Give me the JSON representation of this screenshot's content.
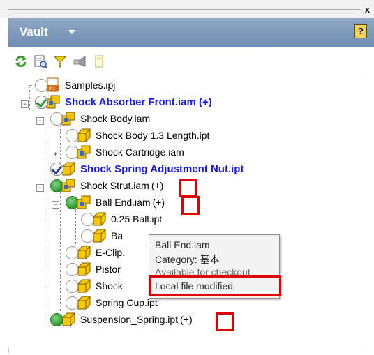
{
  "panel": {
    "title": "Vault",
    "help_label": "?",
    "close_label": "x"
  },
  "toolbar": {
    "buttons": [
      {
        "icon": "refresh-icon"
      },
      {
        "icon": "search-icon"
      },
      {
        "icon": "filter-icon"
      },
      {
        "icon": "settings-icon"
      },
      {
        "icon": "document-icon"
      }
    ]
  },
  "tree": {
    "items": [
      {
        "label": "Samples.ipj",
        "status": "empty",
        "icon": "ipj"
      },
      {
        "label": "Shock Absorber Front.iam (+)",
        "status": "check-green",
        "icon": "assembly",
        "bold": true
      },
      {
        "label": "Shock Body.iam",
        "status": "empty",
        "icon": "assembly"
      },
      {
        "label": "Shock Body 1.3 Length.ipt",
        "status": "empty",
        "icon": "part"
      },
      {
        "label": "Shock Cartridge.iam",
        "status": "empty",
        "icon": "assembly"
      },
      {
        "label": "Shock Spring Adjustment Nut.ipt",
        "status": "check",
        "icon": "part",
        "bold": true
      },
      {
        "label": "Shock Strut.iam",
        "suffix": "(+)",
        "status": "green",
        "icon": "assembly"
      },
      {
        "label": "Ball End.iam",
        "suffix": "(+)",
        "status": "green",
        "icon": "assembly"
      },
      {
        "label": "0.25 Ball.ipt",
        "status": "empty",
        "icon": "part"
      },
      {
        "label": "Ba",
        "status": "empty",
        "icon": "part"
      },
      {
        "label": "E-Clip.",
        "status": "empty",
        "icon": "part"
      },
      {
        "label": "Pistor",
        "status": "empty",
        "icon": "part"
      },
      {
        "label": "Shock",
        "status": "empty",
        "icon": "part"
      },
      {
        "label": "Spring Cup.ipt",
        "status": "empty",
        "icon": "part"
      },
      {
        "label": "Suspension_Spring.ipt",
        "suffix": "(+)",
        "status": "green",
        "icon": "part"
      }
    ]
  },
  "tooltip": {
    "title": "Ball End.iam",
    "category": "Category: 基本",
    "availability": "Available for checkout",
    "state": "Local file modified"
  },
  "colors": {
    "title_bar": "#7f9abd",
    "highlight": "#e00000",
    "bold_label": "#1a1adc",
    "status_green": "#2e9a2e"
  }
}
